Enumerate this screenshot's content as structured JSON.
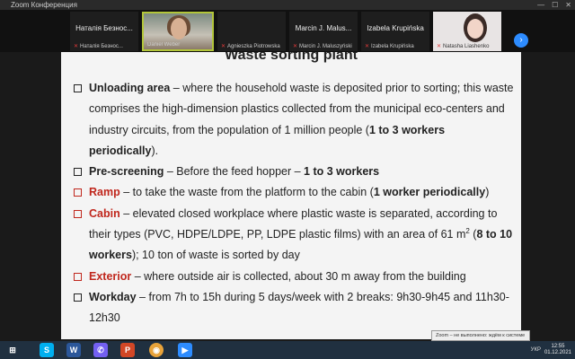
{
  "titlebar": {
    "title": "Zoom Конференция",
    "ctrl_min": "—",
    "ctrl_max": "☐",
    "ctrl_close": "✕"
  },
  "participants": [
    {
      "name": "Наталія Безнос...",
      "sub": "Наталія Безнос..."
    },
    {
      "name": "",
      "sub": "Daniel Weber"
    },
    {
      "name": "",
      "sub": "Agnieszka Piotrowska"
    },
    {
      "name": "Marcin J. Malus...",
      "sub": "Marcin J. Maluszyński"
    },
    {
      "name": "Izabela Krupińska",
      "sub": "Izabela Krupińska"
    },
    {
      "name": "",
      "sub": "Natasha Liashenko"
    }
  ],
  "icons": {
    "mic_muted": "mic-off-icon",
    "next": "chevron-right-icon",
    "start": "windows-start-icon"
  },
  "next_label": "›",
  "slide": {
    "title": "Waste sorting plant",
    "bullets": [
      {
        "keyword": "Unloading area",
        "text": " – where the household waste is deposited prior to sorting; this waste comprises the high-dimension plastics collected from the municipal eco-centers and industry circuits, from the population of 1 million people (",
        "bold": "1 to 3 workers periodically",
        "tail": ").",
        "red": false
      },
      {
        "keyword": "Pre-screening",
        "text": " – Before the feed hopper – ",
        "bold": "1 to 3 workers",
        "tail": "",
        "red": false
      },
      {
        "keyword": "Ramp",
        "text": " – to take the waste from the platform to the cabin (",
        "bold": "1 worker periodically",
        "tail": ")",
        "red": true
      },
      {
        "keyword": "Cabin",
        "text": " – elevated closed workplace where plastic waste is separated, according to their types (PVC, HDPE/LDPE, PP, LDPE plastic films) with an area of 61 m",
        "sup": "2",
        "text2": " (",
        "bold": "8 to 10 workers",
        "tail": "); 10 ton of waste is sorted by day",
        "red": true
      },
      {
        "keyword": "Exterior",
        "text": " – where outside air is collected, about 30 m away from the building",
        "bold": "",
        "tail": "",
        "red": true
      },
      {
        "keyword": "Workday",
        "text": " – from 7h to 15h during 5 days/week with 2 breaks: 9h30-9h45 and 11h30-12h30",
        "bold": "",
        "tail": "",
        "red": false
      }
    ]
  },
  "notification": "Zoom – не выполнено: ждём к системе",
  "taskbar": {
    "apps": [
      {
        "name": "windows-start",
        "glyph": "⊞",
        "color": "#203040"
      },
      {
        "name": "skype",
        "glyph": "S",
        "color": "#00aff0"
      },
      {
        "name": "word",
        "glyph": "W",
        "color": "#2b579a"
      },
      {
        "name": "viber",
        "glyph": "✆",
        "color": "#7360f2"
      },
      {
        "name": "powerpoint",
        "glyph": "P",
        "color": "#d24726"
      },
      {
        "name": "chrome",
        "glyph": "◉",
        "color": "#e8a33a"
      },
      {
        "name": "zoom",
        "glyph": "▶",
        "color": "#2d8cff"
      }
    ],
    "time": "12:55",
    "date": "01.12.2021",
    "lang": "УКР"
  },
  "colors": {
    "accent_red": "#c0271d",
    "active_border": "#b3c63a",
    "zoom_blue": "#2d8cff"
  }
}
